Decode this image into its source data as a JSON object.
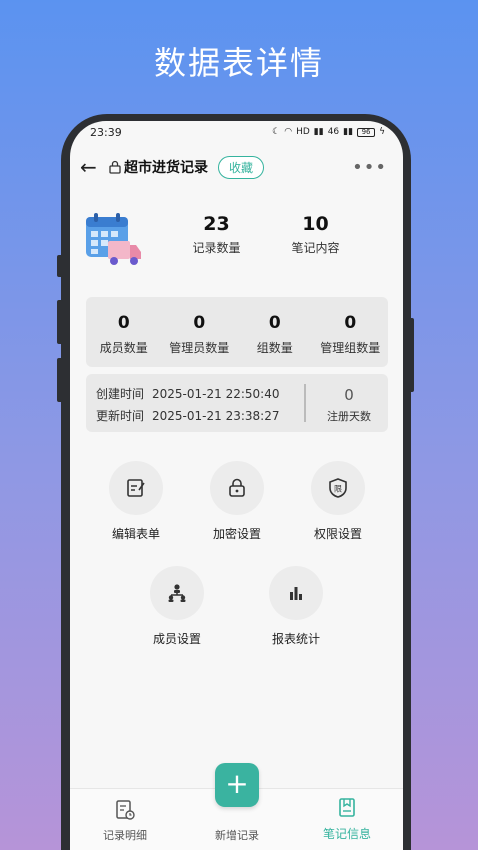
{
  "promo": {
    "title": "数据表详情"
  },
  "status": {
    "time": "23:39",
    "signal1": "HD",
    "signal2": "46",
    "battery": "96"
  },
  "nav": {
    "title": "超市进货记录",
    "favorite_label": "收藏",
    "more": "•••",
    "back": "←"
  },
  "overview": {
    "stats": [
      {
        "value": "23",
        "label": "记录数量"
      },
      {
        "value": "10",
        "label": "笔记内容"
      }
    ]
  },
  "counts": [
    {
      "value": "0",
      "label": "成员数量"
    },
    {
      "value": "0",
      "label": "管理员数量"
    },
    {
      "value": "0",
      "label": "组数量"
    },
    {
      "value": "0",
      "label": "管理组数量"
    }
  ],
  "times": {
    "created_label": "创建时间",
    "created_value": "2025-01-21 22:50:40",
    "updated_label": "更新时间",
    "updated_value": "2025-01-21 23:38:27",
    "days_value": "0",
    "days_label": "注册天数"
  },
  "actions": [
    {
      "label": "编辑表单",
      "icon": "edit-form-icon"
    },
    {
      "label": "加密设置",
      "icon": "lock-icon"
    },
    {
      "label": "权限设置",
      "icon": "shield-icon"
    },
    {
      "label": "成员设置",
      "icon": "members-icon"
    },
    {
      "label": "报表统计",
      "icon": "bar-chart-icon"
    }
  ],
  "tabs": [
    {
      "label": "记录明细",
      "icon": "record-detail-icon"
    },
    {
      "label": "新增记录",
      "icon": "plus-icon"
    },
    {
      "label": "笔记信息",
      "icon": "note-info-icon",
      "active": true
    }
  ],
  "colors": {
    "accent": "#35b39e",
    "bg_top": "#5b93f0",
    "bg_bottom": "#b694d8"
  }
}
